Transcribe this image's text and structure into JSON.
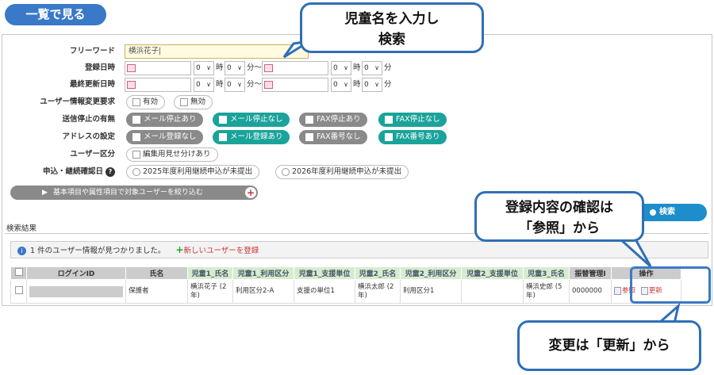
{
  "header": {
    "title": "一覧で見る"
  },
  "form": {
    "freeword": {
      "label": "フリーワード",
      "value": "横浜花子|"
    },
    "reg_date": {
      "label": "登録日時"
    },
    "upd_date": {
      "label": "最終更新日時"
    },
    "time": {
      "hour_val": "0",
      "min_val": "0",
      "hour_unit": "時",
      "min_unit": "分",
      "tilde": "分〜",
      "min_end": "分"
    },
    "user_info": {
      "label": "ユーザー情報変更要求",
      "opt1": "有効",
      "opt2": "無効"
    },
    "send_stop": {
      "label": "送信停止の有無",
      "opts": [
        "メール停止あり",
        "メール停止なし",
        "FAX停止あり",
        "FAX停止なし"
      ]
    },
    "address": {
      "label": "アドレスの設定",
      "opts": [
        "メール登録なし",
        "メール登録あり",
        "FAX番号なし",
        "FAX番号あり"
      ]
    },
    "user_kind": {
      "label": "ユーザー区分",
      "opt1": "編集用見せ分けあり"
    },
    "apply": {
      "label": "申込・継続確認日",
      "help": "?",
      "opt1": "2025年度利用継続申込が未提出",
      "opt2": "2026年度利用継続申込が未提出"
    },
    "expander": {
      "label": "基本項目や属性項目で対象ユーザーを絞り込む",
      "arrow": "▶",
      "plus": "+"
    },
    "search_label": "検索"
  },
  "results": {
    "title": "検索結果",
    "info_icon": "i",
    "info_text": "1 件のユーザー情報が見つかりました。",
    "new_user_plus": "+",
    "new_user_link": "新しいユーザーを登録",
    "columns": [
      "",
      "ログインID",
      "氏名",
      "児童1_氏名",
      "児童1_利用区分",
      "児童1_支援単位",
      "児童2_氏名",
      "児童2_利用区分",
      "児童2_支援単位",
      "児童3_氏名",
      "振替管理I",
      "操作"
    ],
    "row": {
      "name": "保護者",
      "c1n": "横浜花子 (2年)",
      "c1k": "利用区分2-A",
      "c1s": "支援の単位1",
      "c2n": "横浜太郎 (2年)",
      "c2k": "利用区分1",
      "c2s": "",
      "c3n": "横浜史郎 (5年)",
      "furi": "0000000",
      "view": "参照",
      "update": "更新"
    }
  },
  "callouts": {
    "c1_line1": "児童名を入力し",
    "c1_line2": "検索",
    "c2_line1": "登録内容の確認は",
    "c2_line2": "「参照」から",
    "c3": "変更は「更新」から"
  },
  "colors": {
    "accent": "#3a78c8",
    "teal": "#1aa39a",
    "gray": "#8a8a8a",
    "callout_border": "#2f6fb5"
  }
}
